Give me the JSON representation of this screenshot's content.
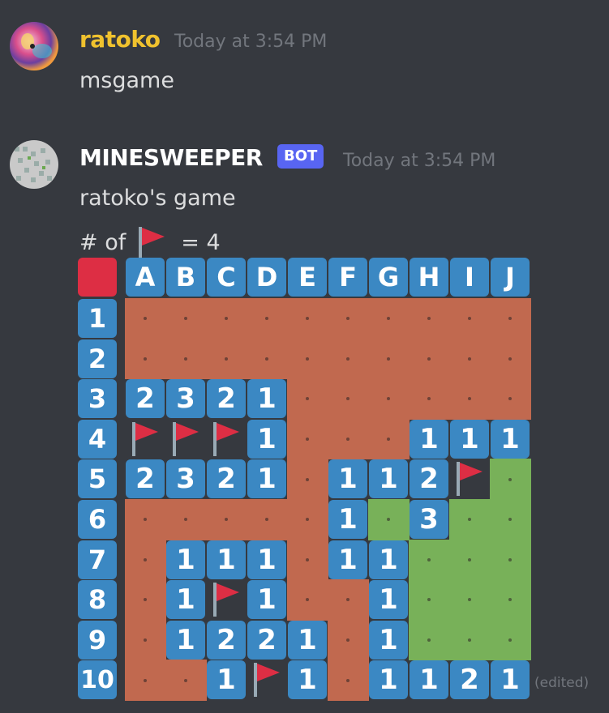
{
  "messages": [
    {
      "username": "ratoko",
      "username_color": "#f0c22e",
      "timestamp": "Today at 3:54 PM",
      "lines": [
        "msgame"
      ]
    },
    {
      "username": "MINESWEEPER",
      "username_color": "#ffffff",
      "badge": "BOT",
      "timestamp": "Today at 3:54 PM",
      "lines": [
        "ratoko's game"
      ],
      "flag_count_prefix": "# of",
      "flag_count_suffix": "= 4",
      "edited": "(edited)"
    }
  ],
  "board": {
    "column_headers": [
      "A",
      "B",
      "C",
      "D",
      "E",
      "F",
      "G",
      "H",
      "I",
      "J"
    ],
    "row_headers": [
      "1",
      "2",
      "3",
      "4",
      "5",
      "6",
      "7",
      "8",
      "9",
      "10"
    ],
    "rows": [
      [
        "O",
        "O",
        "O",
        "O",
        "O",
        "O",
        "O",
        "O",
        "O",
        "O"
      ],
      [
        "O",
        "O",
        "O",
        "O",
        "O",
        "O",
        "O",
        "O",
        "O",
        "O"
      ],
      [
        "2",
        "3",
        "2",
        "1",
        "O",
        "O",
        "O",
        "O",
        "O",
        "O"
      ],
      [
        "F",
        "F",
        "F",
        "1",
        "O",
        "O",
        "O",
        "1",
        "1",
        "1"
      ],
      [
        "2",
        "3",
        "2",
        "1",
        "O",
        "1",
        "1",
        "2",
        "F",
        "G"
      ],
      [
        "O",
        "O",
        "O",
        "O",
        "O",
        "1",
        "G",
        "3",
        "G",
        "G"
      ],
      [
        "O",
        "1",
        "1",
        "1",
        "O",
        "1",
        "1",
        "G",
        "G",
        "G"
      ],
      [
        "O",
        "1",
        "F",
        "1",
        "O",
        "O",
        "1",
        "G",
        "G",
        "G"
      ],
      [
        "O",
        "1",
        "2",
        "2",
        "1",
        "O",
        "1",
        "G",
        "G",
        "G"
      ],
      [
        "O",
        "O",
        "1",
        "F",
        "1",
        "O",
        "1",
        "1",
        "2",
        "1"
      ]
    ],
    "colors": {
      "hidden": "#c1694f",
      "revealed": "#3b88c3",
      "empty": "#78b159",
      "corner": "#dd2e44",
      "flag": "#dd2e44"
    }
  }
}
